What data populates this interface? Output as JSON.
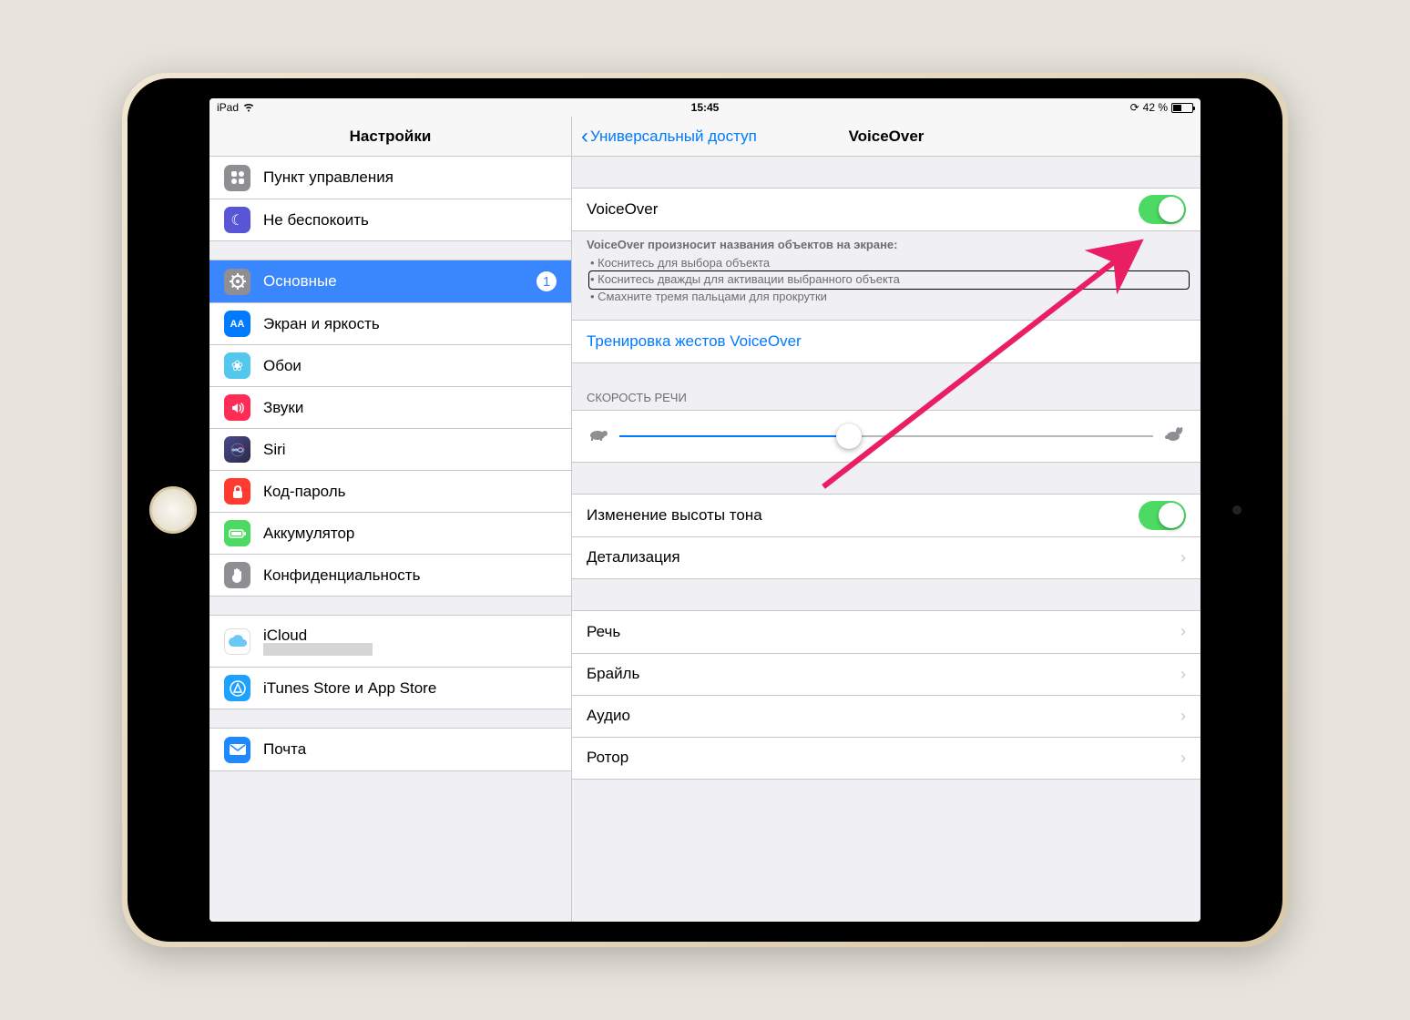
{
  "status": {
    "device": "iPad",
    "time": "15:45",
    "battery_pct": "42 %"
  },
  "sidebar": {
    "title": "Настройки",
    "group1": [
      {
        "label": "Пункт управления",
        "icon_bg": "#8e8e93",
        "icon": "⚙"
      },
      {
        "label": "Не беспокоить",
        "icon_bg": "#5856d6",
        "icon": "☾"
      }
    ],
    "group2": [
      {
        "label": "Основные",
        "icon_bg": "#8e8e93",
        "icon": "⚙",
        "badge": "1",
        "selected": true
      },
      {
        "label": "Экран и яркость",
        "icon_bg": "#007aff",
        "icon": "AA"
      },
      {
        "label": "Обои",
        "icon_bg": "#54c7ec",
        "icon": "❀"
      },
      {
        "label": "Звуки",
        "icon_bg": "#ff2d55",
        "icon": "🔊"
      },
      {
        "label": "Siri",
        "icon_bg": "#000000",
        "icon": "●"
      },
      {
        "label": "Код-пароль",
        "icon_bg": "#ff3b30",
        "icon": "🔒"
      },
      {
        "label": "Аккумулятор",
        "icon_bg": "#4cd964",
        "icon": "▮"
      },
      {
        "label": "Конфиденциальность",
        "icon_bg": "#8e8e93",
        "icon": "✋"
      }
    ],
    "group3": [
      {
        "label": "iCloud",
        "icon_bg": "#ffffff",
        "icon": "☁",
        "icon_color": "#2ca9e1",
        "has_sub": true
      },
      {
        "label": "iTunes Store и App Store",
        "icon_bg": "#1fa2ff",
        "icon": "Ⓐ"
      }
    ],
    "group4": [
      {
        "label": "Почта",
        "icon_bg": "#1e88ff",
        "icon": "✉"
      }
    ]
  },
  "detail": {
    "back": "Универсальный доступ",
    "title": "VoiceOver",
    "voiceover": {
      "label": "VoiceOver",
      "on": true
    },
    "description": {
      "title": "VoiceOver произносит названия объектов на экране:",
      "bullets": [
        "Коснитесь для выбора объекта",
        "Коснитесь дважды для активации выбранного объекта",
        "Смахните тремя пальцами для прокрутки"
      ]
    },
    "practice": "Тренировка жестов VoiceOver",
    "speed": {
      "header": "СКОРОСТЬ РЕЧИ",
      "value_pct": 43
    },
    "pitch": {
      "label": "Изменение высоты тона",
      "on": true
    },
    "detalization": "Детализация",
    "nav": {
      "speech": "Речь",
      "braille": "Брайль",
      "audio": "Аудио",
      "rotor": "Ротор"
    }
  }
}
